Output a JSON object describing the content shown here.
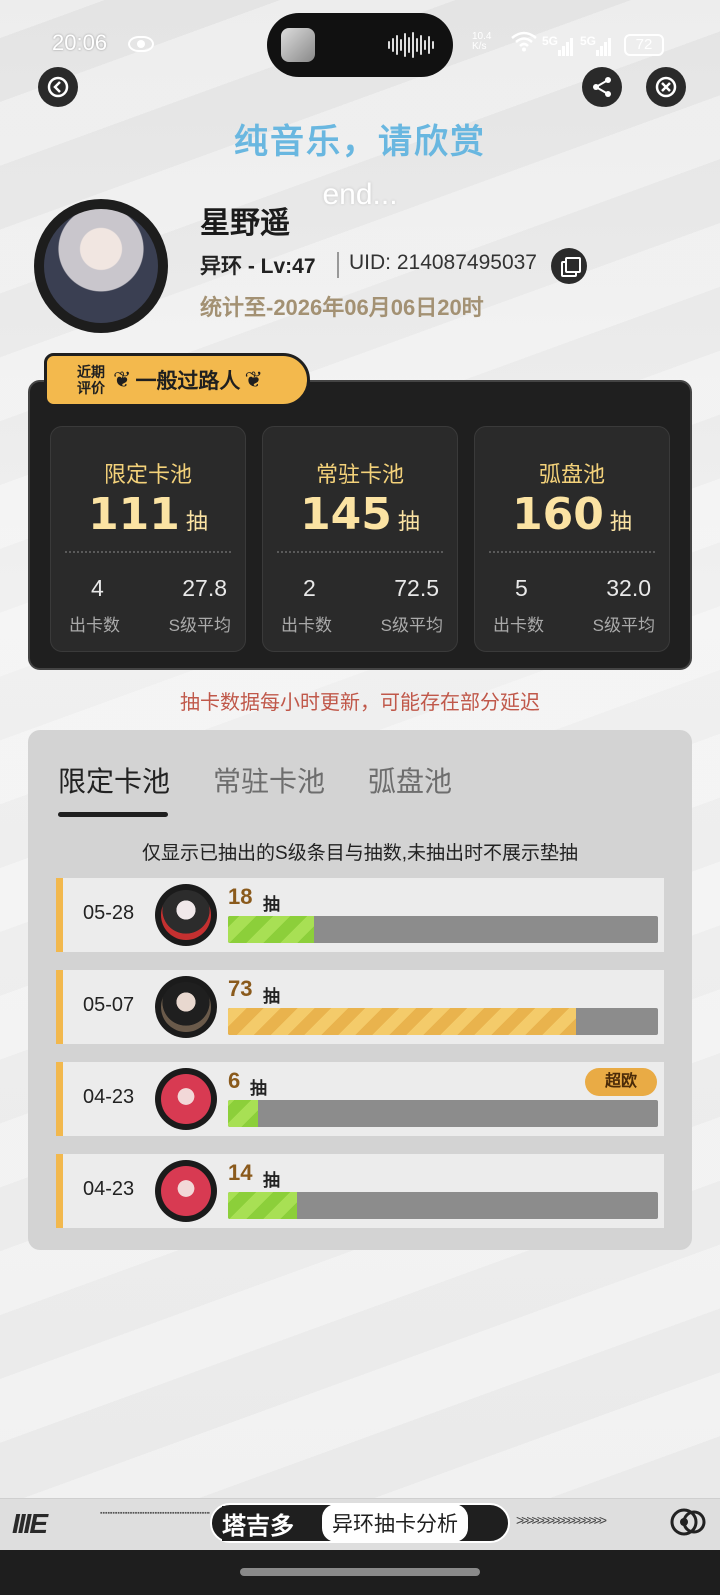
{
  "status_bar": {
    "time": "20:06",
    "net_speed_top": "10.4",
    "net_speed_bottom": "K/s",
    "signal_1": "5G",
    "signal_2": "5G",
    "battery": "72"
  },
  "header": {
    "lyric_main": "纯音乐，请欣赏",
    "lyric_sub": "end..."
  },
  "profile": {
    "name": "星野遥",
    "game_level": "异环 - Lv:47",
    "uid": "UID: 214087495037",
    "stat_date": "统计至-2026年06月06日20时"
  },
  "evaluation": {
    "tag_line1": "近期",
    "tag_line2": "评价",
    "text": "一般过路人"
  },
  "pools": [
    {
      "title": "限定卡池",
      "count": "111",
      "unit": "抽",
      "cards": "4",
      "cards_label": "出卡数",
      "avg": "27.8",
      "avg_label": "S级平均"
    },
    {
      "title": "常驻卡池",
      "count": "145",
      "unit": "抽",
      "cards": "2",
      "cards_label": "出卡数",
      "avg": "72.5",
      "avg_label": "S级平均"
    },
    {
      "title": "弧盘池",
      "count": "160",
      "unit": "抽",
      "cards": "5",
      "cards_label": "出卡数",
      "avg": "32.0",
      "avg_label": "S级平均"
    }
  ],
  "notice": "抽卡数据每小时更新，可能存在部分延迟",
  "tabs": [
    "限定卡池",
    "常驻卡池",
    "弧盘池"
  ],
  "active_tab": "限定卡池",
  "hint": "仅显示已抽出的S级条目与抽数,未抽出时不展示垫抽",
  "records": [
    {
      "date": "05-28",
      "pulls": "18",
      "unit": "抽",
      "fill": 0.2,
      "color": "#a8e054",
      "badge": ""
    },
    {
      "date": "05-07",
      "pulls": "73",
      "unit": "抽",
      "fill": 0.81,
      "color": "#f4cb6a",
      "badge": ""
    },
    {
      "date": "04-23",
      "pulls": "6",
      "unit": "抽",
      "fill": 0.07,
      "color": "#a8e054",
      "badge": "超欧"
    },
    {
      "date": "04-23",
      "pulls": "14",
      "unit": "抽",
      "fill": 0.16,
      "color": "#a8e054",
      "badge": ""
    }
  ],
  "footer": {
    "logo": "IIIE",
    "brand": "塔吉多",
    "label": "异环抽卡分析",
    "arrows": ">>>>>>>>>>>>>>>>>"
  },
  "icons": {
    "back": "back-icon",
    "share": "share-icon",
    "close": "close-icon",
    "copy": "copy-icon",
    "laurel": "laurel-icon",
    "disc": "disc-icon"
  }
}
